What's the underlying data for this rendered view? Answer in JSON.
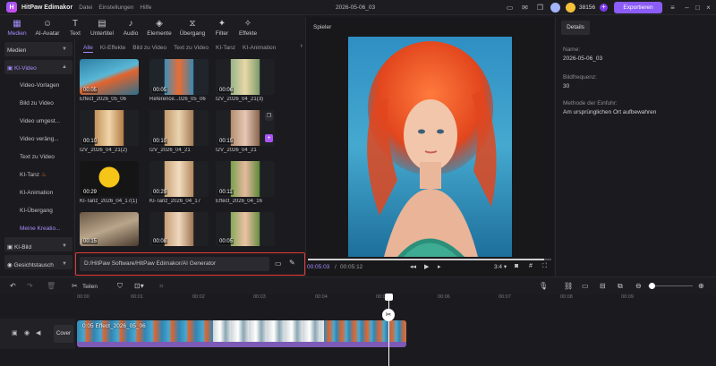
{
  "app": {
    "name": "HitPaw Edimakor",
    "menus": [
      "Datei",
      "Einstellungen",
      "Hilfe"
    ],
    "project_name": "2026-05-06_03",
    "coins": "38156",
    "export_label": "Exportieren"
  },
  "toolbar": [
    {
      "label": "Medien",
      "icon": "media-icon",
      "active": true
    },
    {
      "label": "AI-Avatar",
      "icon": "avatar-icon"
    },
    {
      "label": "Text",
      "icon": "text-icon"
    },
    {
      "label": "Untertitel",
      "icon": "subtitle-icon"
    },
    {
      "label": "Audio",
      "icon": "audio-icon"
    },
    {
      "label": "Elemente",
      "icon": "elements-icon"
    },
    {
      "label": "Übergang",
      "icon": "transition-icon"
    },
    {
      "label": "Filter",
      "icon": "filter-icon"
    },
    {
      "label": "Effekte",
      "icon": "effects-icon"
    }
  ],
  "sidebar": {
    "groups": [
      "Medien",
      "KI-Video",
      "KI-Bild",
      "Gesichtstausch"
    ],
    "items": [
      "Video-Vorlagen",
      "Bild zu Video",
      "Video umgest...",
      "Video veräng...",
      "Text zu Video",
      "KI-Tanz",
      "KI-Animation",
      "KI-Übergang",
      "Meine Kreatio..."
    ]
  },
  "media": {
    "tabs": [
      "Alle",
      "KI-Effekte",
      "Bild zu Video",
      "Text zu Video",
      "KI-Tanz",
      "KI-Animation"
    ],
    "items": [
      {
        "name": "Effect_2026_05_06",
        "duration": "00:05"
      },
      {
        "name": "Reference...026_05_06",
        "duration": "00:05"
      },
      {
        "name": "I2V_2026_04_21(3)",
        "duration": "00:06"
      },
      {
        "name": "I2V_2026_04_21(2)",
        "duration": "00:10"
      },
      {
        "name": "I2V_2026_04_21",
        "duration": "00:10"
      },
      {
        "name": "I2V_2026_04_21",
        "duration": "00:15"
      },
      {
        "name": "KI-Tanz_2026_04_17(1)",
        "duration": "00:29"
      },
      {
        "name": "KI-Tanz_2026_04_17",
        "duration": "00:29"
      },
      {
        "name": "Effect_2026_04_16",
        "duration": "00:11"
      },
      {
        "name": "",
        "duration": "00:15"
      },
      {
        "name": "",
        "duration": "00:08"
      },
      {
        "name": "",
        "duration": "00:05"
      }
    ],
    "path": "D:/HitPaw Software/HitPaw Edimakor/AI Generator"
  },
  "player": {
    "title": "Spieler",
    "current": "00:05:03",
    "total": "00:05:12",
    "ratio": "3:4",
    "progress": 0.97
  },
  "details": {
    "tab": "Details",
    "fields": [
      {
        "label": "Name:",
        "value": "2026-05-06_03"
      },
      {
        "label": "Bildfrequenz:",
        "value": "30"
      },
      {
        "label": "Methode der Einfuhr:",
        "value": "Am ursprünglichen Ort aufbewahren"
      }
    ]
  },
  "timeline": {
    "split_label": "Teilen",
    "ticks": [
      "00:00",
      "00:01",
      "00:02",
      "00:03",
      "00:04",
      "00:05",
      "00:06",
      "00:07",
      "00:08",
      "00:09"
    ],
    "cover_label": "Cover",
    "clip_label": "0:05 Effect_2026_05_06"
  }
}
